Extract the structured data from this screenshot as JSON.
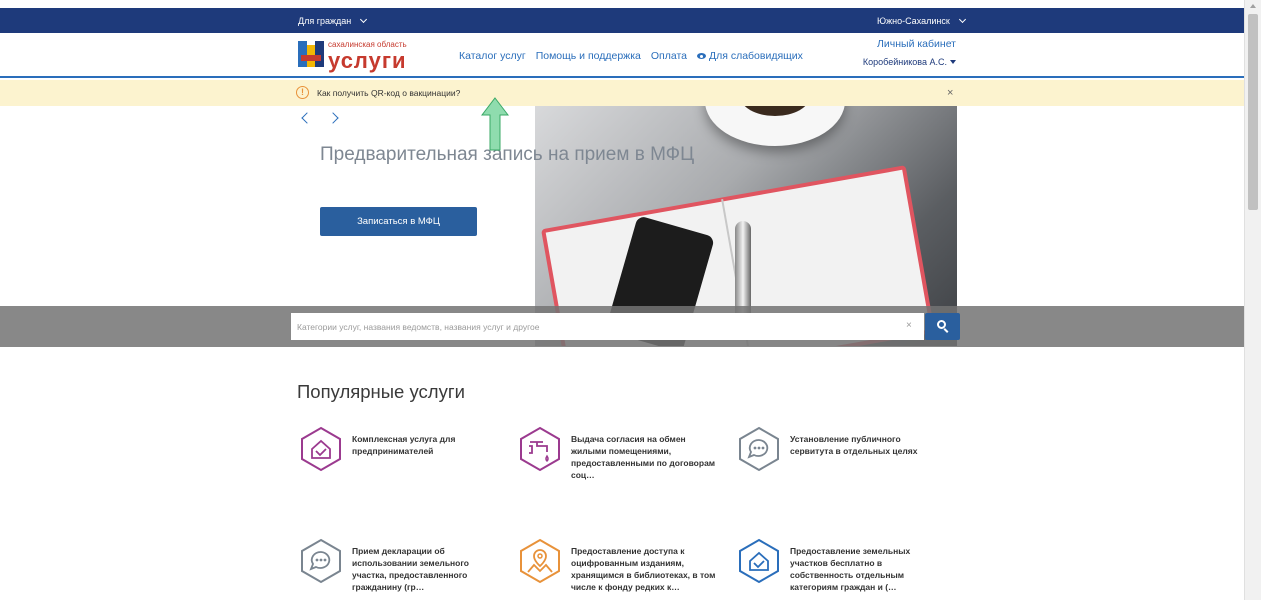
{
  "topbar": {
    "audience_label": "Для граждан",
    "city_label": "Южно-Сахалинск"
  },
  "header": {
    "logo_small": "сахалинская область",
    "logo_big": "услуги",
    "nav": [
      "Каталог услуг",
      "Помощь и поддержка",
      "Оплата",
      "Для слабовидящих"
    ],
    "cabinet_link": "Личный кабинет",
    "user_name": "Коробейникова А.С."
  },
  "alert": {
    "text": "Как получить QR-код о вакцинации?",
    "close": "×"
  },
  "hero": {
    "title": "Предварительная запись на прием в МФЦ",
    "button": "Записаться в МФЦ"
  },
  "search": {
    "placeholder": "Категории услуг, названия ведомств, названия услуг и другое",
    "clear": "×"
  },
  "popular": {
    "title": "Популярные услуги",
    "items": [
      {
        "label": "Комплексная услуга для предпринимателей",
        "icon": "house-check-icon",
        "color": "#9b3a8f"
      },
      {
        "label": "Выдача согласия на обмен жилыми помещениями, предоставленными по договорам соц…",
        "icon": "tap-water-icon",
        "color": "#9b3a8f"
      },
      {
        "label": "Установление публичного сервитута в отдельных целях",
        "icon": "chat-bubble-icon",
        "color": "#7a8590"
      },
      {
        "label": "Прием декларации об использовании земельного участка, предоставленного гражданину (гр…",
        "icon": "chat-bubble-icon",
        "color": "#7a8590"
      },
      {
        "label": "Предоставление доступа к оцифрованным изданиям, хранящимся в библиотеках, в том числе к фонду редких к…",
        "icon": "map-pin-icon",
        "color": "#e8923a"
      },
      {
        "label": "Предоставление земельных участков бесплатно в собственность отдельным категориям граждан и (…",
        "icon": "house-check-icon",
        "color": "#2a6ebb"
      }
    ]
  },
  "colors": {
    "topbar": "#1e3a7b",
    "primary": "#2a5f9e",
    "alert_bg": "#fcf3cf",
    "annotation_arrow": "#6ecf9a"
  }
}
